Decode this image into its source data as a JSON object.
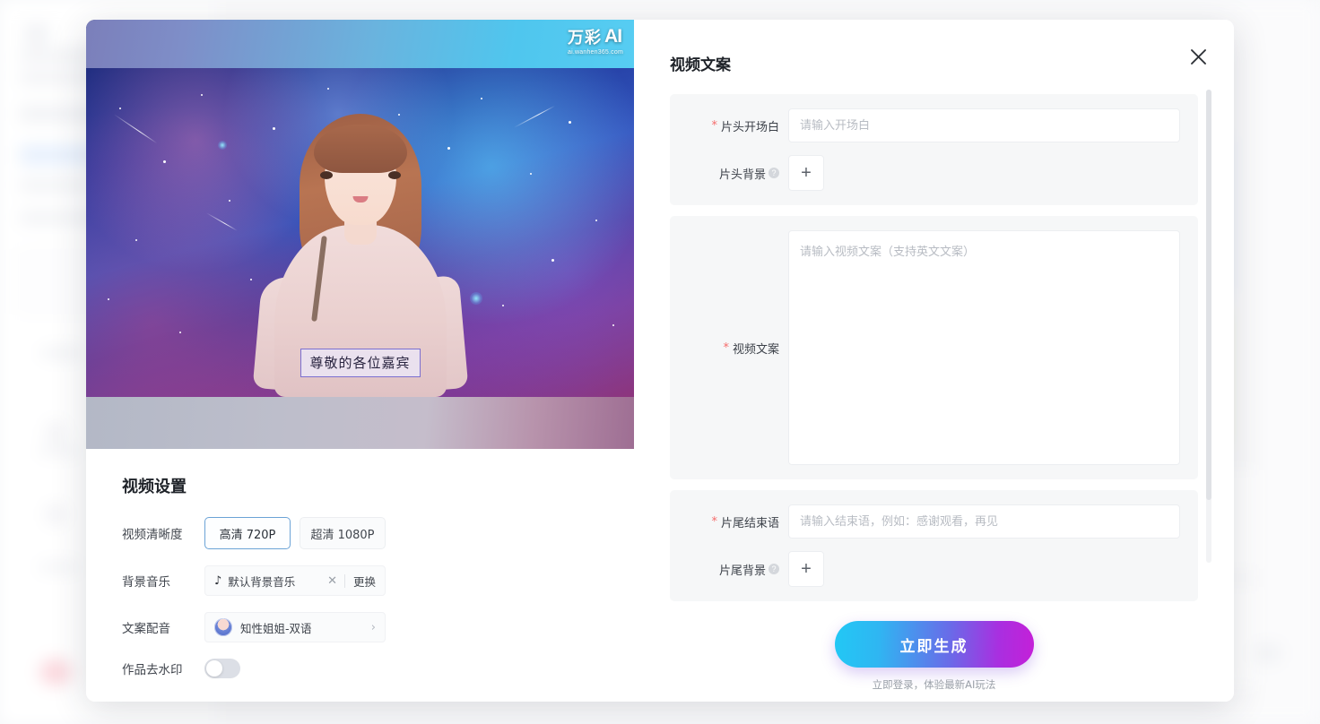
{
  "modal": {
    "close_icon": "close-icon"
  },
  "video_preview": {
    "watermark_brand": "万彩",
    "watermark_ai": "AI",
    "watermark_url": "ai.wanhen365.com",
    "subtitle": "尊敬的各位嘉宾"
  },
  "settings": {
    "title": "视频设置",
    "resolution": {
      "label": "视频清晰度",
      "options": [
        {
          "label": "高清 720P",
          "selected": true
        },
        {
          "label": "超清 1080P",
          "selected": false
        }
      ]
    },
    "music": {
      "label": "背景音乐",
      "note_icon": "music-note-icon",
      "value": "默认背景音乐",
      "clear_icon": "✕",
      "change_label": "更换"
    },
    "voice": {
      "label": "文案配音",
      "value": "知性姐姐-双语",
      "arrow_icon": "›"
    },
    "watermark_toggle": {
      "label": "作品去水印",
      "enabled": false
    }
  },
  "panel": {
    "title": "视频文案",
    "opening": {
      "label": "片头开场白",
      "required": true,
      "placeholder": "请输入开场白",
      "value": ""
    },
    "opening_bg": {
      "label": "片头背景",
      "help": "?",
      "add_icon": "+"
    },
    "script": {
      "label": "视频文案",
      "required": true,
      "placeholder": "请输入视频文案（支持英文文案）",
      "value": ""
    },
    "ending": {
      "label": "片尾结束语",
      "required": true,
      "placeholder": "请输入结束语，例如：感谢观看，再见",
      "value": ""
    },
    "ending_bg": {
      "label": "片尾背景",
      "help": "?",
      "add_icon": "+"
    },
    "generate_label": "立即生成",
    "login_hint": "立即登录，体验最新AI玩法"
  },
  "colors": {
    "accent_start": "#22C8F5",
    "accent_end": "#C420D8",
    "required_red": "#F56C6C",
    "selected_border": "#6BA3D6"
  }
}
